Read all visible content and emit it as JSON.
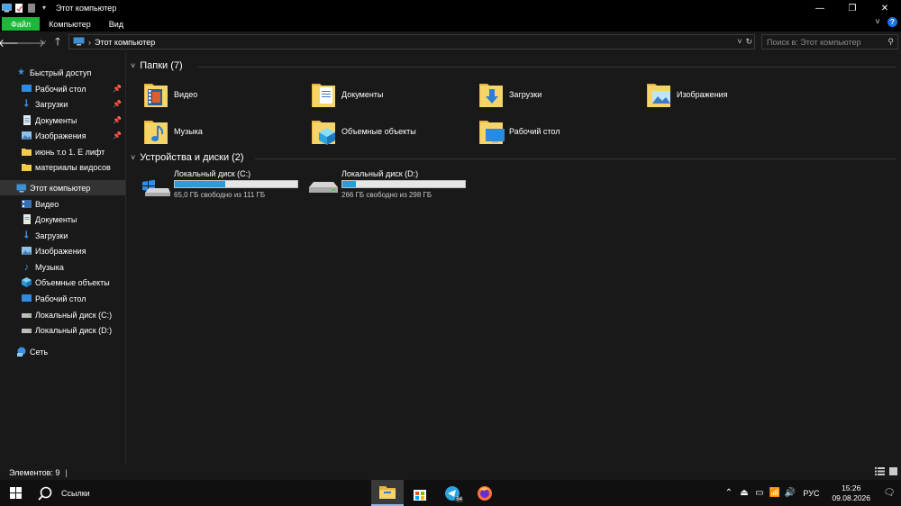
{
  "window": {
    "title": "Этот компьютер",
    "quick_access_toolbar": [
      "computer-icon",
      "properties-icon",
      "new-folder-icon",
      "dropdown-icon"
    ],
    "controls": {
      "minimize": "—",
      "maximize": "❐",
      "close": "✕"
    }
  },
  "ribbon": {
    "tabs": [
      "Файл",
      "Компьютер",
      "Вид"
    ],
    "active_color": "#1db83b",
    "expand": "˅",
    "help": "?"
  },
  "address": {
    "path_item": "Этот компьютер",
    "search_placeholder": "Поиск в: Этот компьютер"
  },
  "nav_pane": {
    "quick_access": {
      "label": "Быстрый доступ",
      "items": [
        {
          "label": "Рабочий стол",
          "pinned": true
        },
        {
          "label": "Загрузки",
          "pinned": true
        },
        {
          "label": "Документы",
          "pinned": true
        },
        {
          "label": "Изображения",
          "pinned": true
        },
        {
          "label": "июнь т.о 1. Е лифт",
          "pinned": false
        },
        {
          "label": "материалы видосов",
          "pinned": false
        }
      ]
    },
    "this_pc": {
      "label": "Этот компьютер",
      "items": [
        {
          "label": "Видео"
        },
        {
          "label": "Документы"
        },
        {
          "label": "Загрузки"
        },
        {
          "label": "Изображения"
        },
        {
          "label": "Музыка"
        },
        {
          "label": "Объемные объекты"
        },
        {
          "label": "Рабочий стол"
        },
        {
          "label": "Локальный диск (C:)"
        },
        {
          "label": "Локальный диск (D:)"
        }
      ]
    },
    "network": {
      "label": "Сеть"
    }
  },
  "content": {
    "folders_header": "Папки (7)",
    "folders": [
      {
        "label": "Видео",
        "icon": "video-folder-icon"
      },
      {
        "label": "Документы",
        "icon": "documents-folder-icon"
      },
      {
        "label": "Загрузки",
        "icon": "downloads-folder-icon"
      },
      {
        "label": "Изображения",
        "icon": "pictures-folder-icon"
      },
      {
        "label": "Музыка",
        "icon": "music-folder-icon"
      },
      {
        "label": "Объемные объекты",
        "icon": "3d-objects-folder-icon"
      },
      {
        "label": "Рабочий стол",
        "icon": "desktop-folder-icon"
      }
    ],
    "drives_header": "Устройства и диски (2)",
    "drives": [
      {
        "label": "Локальный диск (C:)",
        "free": "65,0 ГБ свободно из 111 ГБ",
        "used_fraction": 0.414
      },
      {
        "label": "Локальный диск (D:)",
        "free": "266 ГБ свободно из 298 ГБ",
        "used_fraction": 0.107
      }
    ]
  },
  "status": {
    "items_count": "Элементов: 9"
  },
  "taskbar": {
    "search_label": "Ссылки",
    "badge": "64",
    "lang": "РУС",
    "time": "15:26",
    "date": "09.08.2026"
  }
}
